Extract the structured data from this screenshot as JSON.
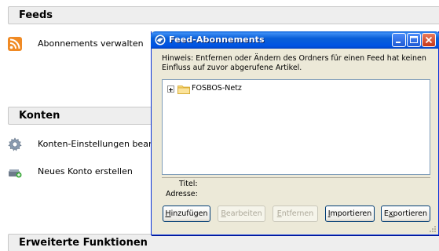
{
  "background": {
    "feeds": {
      "header": "Feeds",
      "item": "Abonnements verwalten"
    },
    "konten": {
      "header": "Konten",
      "items": [
        "Konten-Einstellungen bearb",
        "Neues Konto erstellen"
      ]
    },
    "advanced": {
      "header": "Erweiterte Funktionen"
    }
  },
  "dialog": {
    "title": "Feed-Abonnements",
    "hint": "Hinweis: Entfernen oder Ändern des Ordners für einen Feed hat keinen Einfluss auf zuvor abgerufene Artikel.",
    "tree": {
      "items": [
        {
          "label": "FOSBOS-Netz",
          "expander": "+"
        }
      ]
    },
    "info": {
      "title_label": "Titel:",
      "address_label": "Adresse:"
    },
    "buttons": {
      "add": {
        "mnemonic": "H",
        "rest": "inzufügen"
      },
      "edit": {
        "mnemonic": "B",
        "rest": "earbeiten"
      },
      "remove": {
        "mnemonic": "E",
        "rest": "ntfernen"
      },
      "import": {
        "mnemonic": "I",
        "rest": "mportieren"
      },
      "export": {
        "prefix": "E",
        "mnemonic": "x",
        "rest": "portieren"
      }
    },
    "colors": {
      "titlebar": "#0054e3",
      "close_button": "#c5371a",
      "dialog_bg": "#ece9d8"
    }
  }
}
